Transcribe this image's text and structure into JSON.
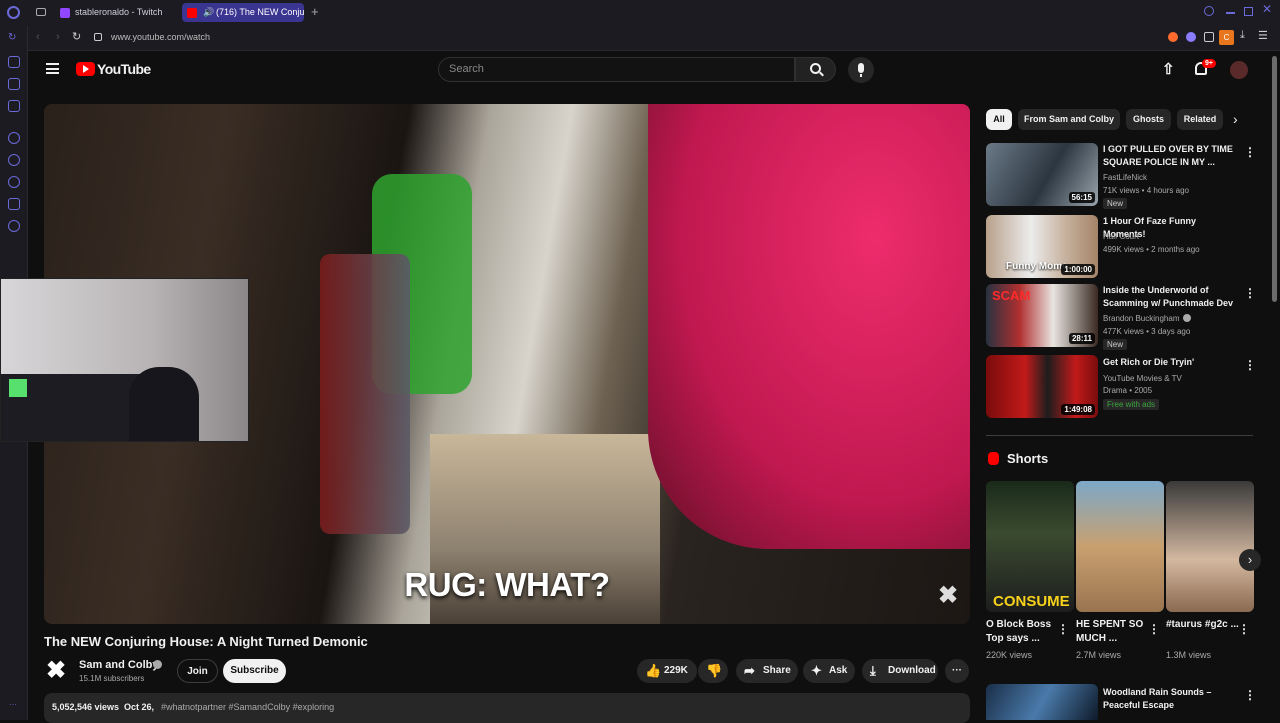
{
  "browser": {
    "tabs": [
      {
        "label": "stableronaldo - Twitch"
      },
      {
        "label": "(716) The NEW Conju"
      }
    ],
    "url": "www.youtube.com/watch",
    "ext_badge": "C"
  },
  "header": {
    "logo_text": "YouTube",
    "search_placeholder": "Search",
    "notification_count": "9+"
  },
  "video": {
    "caption": "RUG: WHAT?",
    "title": "The NEW Conjuring House: A Night Turned Demonic"
  },
  "channel": {
    "name": "Sam and Colby",
    "subscribers": "15.1M subscribers",
    "join_label": "Join",
    "subscribe_label": "Subscribe"
  },
  "actions": {
    "likes": "229K",
    "share_label": "Share",
    "ask_label": "Ask",
    "download_label": "Download"
  },
  "description": {
    "views": "5,052,546 views",
    "date": "Oct 26,",
    "tags": "#whatnotpartner #SamandColby #exploring"
  },
  "chips": [
    "All",
    "From Sam and Colby",
    "Ghosts",
    "Related"
  ],
  "recommendations": [
    {
      "title": "I GOT PULLED OVER BY TIME SQUARE POLICE IN MY ...",
      "channel": "FastLifeNick",
      "meta": "71K views • 4 hours ago",
      "badge": "New",
      "duration": "56:15",
      "verified": false
    },
    {
      "title": "1 Hour Of Faze Funny Moments!",
      "channel": "Half Court",
      "meta": "499K views • 2 months ago",
      "badge": "",
      "duration": "1:00:00",
      "thumb_text": "Funny Mome",
      "verified": false
    },
    {
      "title": "Inside the Underworld of Scamming w/ Punchmade Dev",
      "channel": "Brandon Buckingham",
      "meta": "477K views • 3 days ago",
      "badge": "New",
      "duration": "28:11",
      "thumb_text": "SCAM",
      "verified": true
    },
    {
      "title": "Get Rich or Die Tryin'",
      "channel": "YouTube Movies & TV",
      "meta": "Drama • 2005",
      "badge": "Free with ads",
      "duration": "1:49:08",
      "verified": false
    },
    {
      "title": "Woodland Rain Sounds – Peaceful Escape",
      "channel": "",
      "meta": "",
      "badge": "",
      "duration": "",
      "verified": false
    }
  ],
  "shorts": {
    "heading": "Shorts",
    "items": [
      {
        "title": "O Block Boss Top says ...",
        "views": "220K views",
        "thumb_text": "CONSUME"
      },
      {
        "title": "HE SPENT SO MUCH ...",
        "views": "2.7M views",
        "thumb_text": ""
      },
      {
        "title": "#taurus #g2c ...",
        "views": "1.3M views",
        "thumb_text": ""
      }
    ]
  },
  "colors": {
    "youtube_red": "#ff0000",
    "background": "#0f0f0f",
    "chip_bg": "#272727",
    "active_chip": "#f1f1f1",
    "badge_green": "#3ea6ff"
  }
}
